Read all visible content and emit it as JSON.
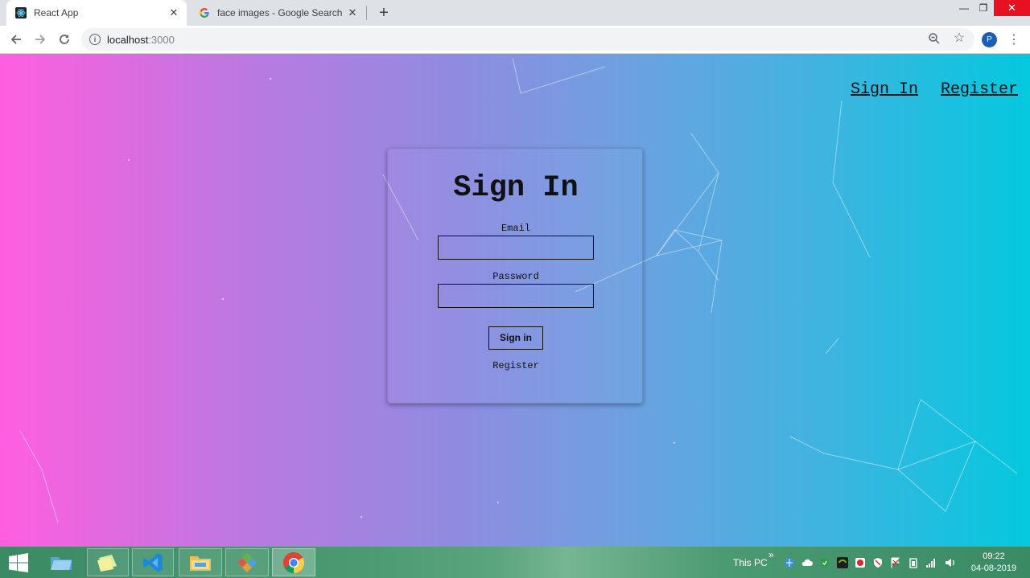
{
  "browser": {
    "tabs": [
      {
        "title": "React App",
        "active": true,
        "favicon": "react-logo-icon"
      },
      {
        "title": "face images - Google Search",
        "active": false,
        "favicon": "google-g-icon"
      }
    ],
    "new_tab": "+",
    "window_controls": {
      "minimize": "—",
      "restore": "❐",
      "close": "✕"
    },
    "address": {
      "host": "localhost",
      "port": ":3000"
    },
    "profile_initial": "P",
    "accent_color": "#1a5fb4"
  },
  "page": {
    "nav": {
      "sign_in": "Sign In",
      "register": "Register"
    },
    "card": {
      "title": "Sign In",
      "email_label": "Email",
      "email_value": "",
      "password_label": "Password",
      "password_value": "",
      "submit_label": "Sign in",
      "register_link": "Register"
    },
    "background_gradient": [
      "#ff5edf",
      "#8e8ce0",
      "#04c8de"
    ]
  },
  "taskbar": {
    "apps": [
      "windows-start-icon",
      "file-explorer-icon",
      "sticky-notes-icon",
      "vscode-icon",
      "folder-icon",
      "paint-icon",
      "chrome-icon"
    ],
    "this_pc_label": "This PC",
    "overflow_label": "»",
    "time": "09:22",
    "date": "04-08-2019"
  }
}
